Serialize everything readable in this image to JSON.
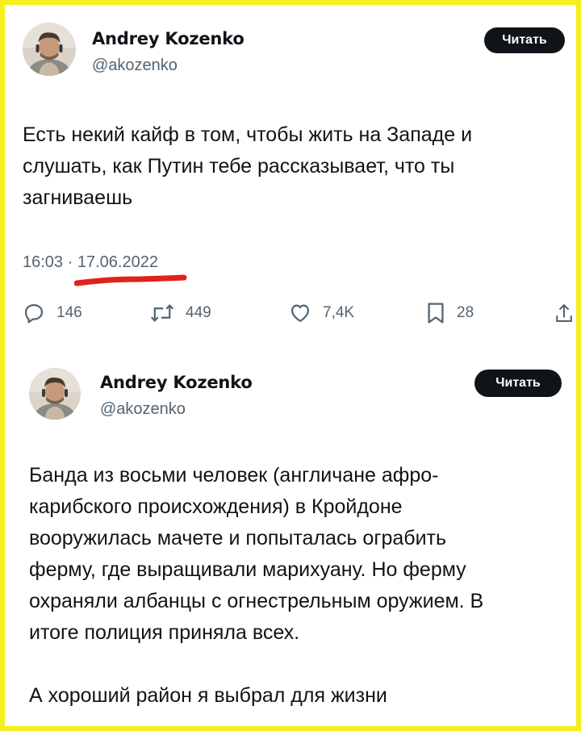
{
  "tweets": [
    {
      "author": "Andrey Kozenko",
      "handle": "@akozenko",
      "read_button": "Читать",
      "text": "Есть некий кайф в том, чтобы жить на Западе и\nслушать, как Путин тебе рассказывает, что ты\nзагниваешь",
      "time": "16:03",
      "separator": "·",
      "date": "17.06.2022",
      "date_highlight_color": "#e0221b",
      "actions": {
        "replies": "146",
        "retweets": "449",
        "likes": "7,4K",
        "bookmarks": "28"
      }
    },
    {
      "author": "Andrey Kozenko",
      "handle": "@akozenko",
      "read_button": "Читать",
      "text": "Банда из восьми человек (англичане афро-\nкарибского происхождения) в Кройдоне\nвооружилась мачете и попыталась ограбить\nферму, где выращивали марихуану. Но ферму\nохраняли албанцы с огнестрельным оружием. В\nитоге полиция приняла всех.\n\nА хороший район я выбрал для жизни"
    }
  ],
  "icons": [
    "reply-icon",
    "retweet-icon",
    "like-icon",
    "bookmark-icon",
    "share-icon"
  ],
  "colors": {
    "frame": "#f4ee1a",
    "text": "#0f1419",
    "secondary_text": "#536471",
    "button_bg": "#0f1419"
  }
}
